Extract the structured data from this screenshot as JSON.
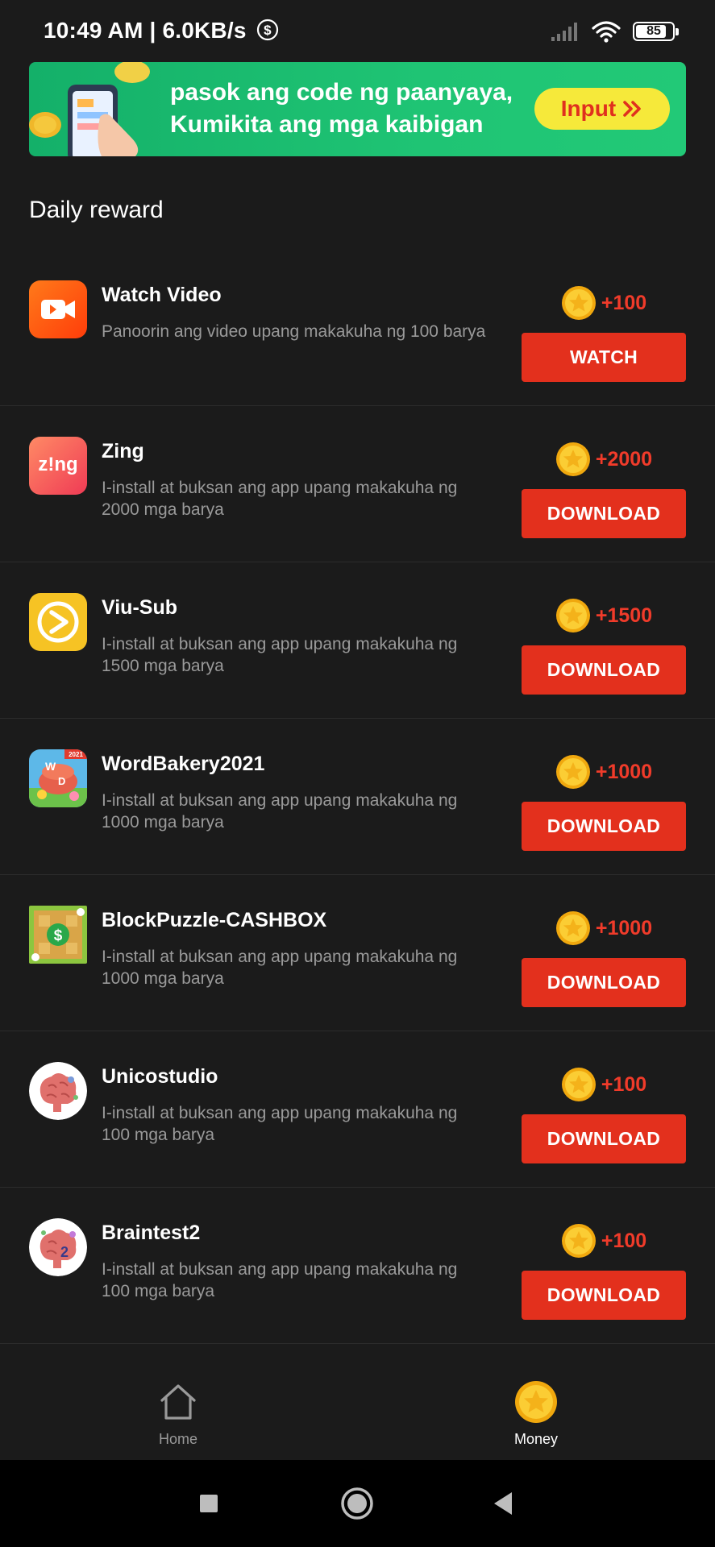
{
  "status_bar": {
    "time_speed": "10:49 AM | 6.0KB/s",
    "battery": "85",
    "battery_level_percent": 85
  },
  "banner": {
    "line1": "pasok ang code ng paanyaya,",
    "line2": "Kumikita ang mga kaibigan",
    "input_label": "Input"
  },
  "section_title": "Daily reward",
  "rewards": [
    {
      "name": "Watch Video",
      "desc": "Panoorin ang video upang makakuha ng 100 barya",
      "reward": "+100",
      "action": "WATCH",
      "icon": "video-camera-icon"
    },
    {
      "name": "Zing",
      "desc": "I-install at buksan ang app upang makakuha ng 2000 mga barya",
      "reward": "+2000",
      "action": "DOWNLOAD",
      "icon": "zing-app-icon"
    },
    {
      "name": "Viu-Sub",
      "desc": "I-install at buksan ang app upang makakuha ng 1500 mga barya",
      "reward": "+1500",
      "action": "DOWNLOAD",
      "icon": "viu-app-icon"
    },
    {
      "name": "WordBakery2021",
      "desc": "I-install at buksan ang app upang makakuha ng 1000 mga barya",
      "reward": "+1000",
      "action": "DOWNLOAD",
      "icon": "wordbakery-app-icon"
    },
    {
      "name": "BlockPuzzle-CASHBOX",
      "desc": "I-install at buksan ang app upang makakuha ng 1000 mga barya",
      "reward": "+1000",
      "action": "DOWNLOAD",
      "icon": "blockpuzzle-app-icon"
    },
    {
      "name": "Unicostudio",
      "desc": "I-install at buksan ang app upang makakuha ng 100 mga barya",
      "reward": "+100",
      "action": "DOWNLOAD",
      "icon": "brain-app-icon"
    },
    {
      "name": "Braintest2",
      "desc": "I-install at buksan ang app upang makakuha ng 100 mga barya",
      "reward": "+100",
      "action": "DOWNLOAD",
      "icon": "brain-app-icon"
    }
  ],
  "bottom_nav": {
    "home_label": "Home",
    "money_label": "Money"
  },
  "colors": {
    "accent": "#e3301d",
    "reward_text": "#f03b2a",
    "background": "#1b1b1b",
    "banner_green": "#1fc474",
    "input_yellow": "#f6e93a"
  }
}
